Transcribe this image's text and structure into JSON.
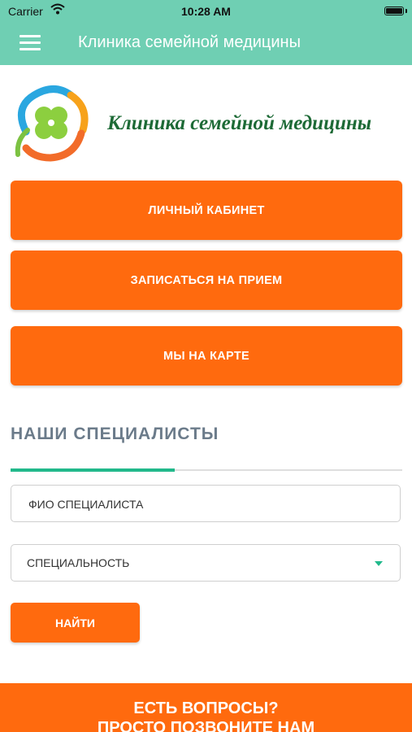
{
  "status_bar": {
    "carrier": "Carrier",
    "time": "10:28 AM"
  },
  "nav": {
    "title": "Клиника семейной медицины",
    "menu_icon": "hamburger-menu-icon"
  },
  "logo": {
    "text": "Клиника семейной медицины",
    "emblem": "clover-logo-icon"
  },
  "buttons": {
    "cabinet": "ЛИЧНЫЙ КАБИНЕТ",
    "appointment": "ЗАПИСАТЬСЯ НА ПРИЕМ",
    "map": "МЫ НА КАРТЕ"
  },
  "specialists": {
    "title": "НАШИ СПЕЦИАЛИСТЫ",
    "name_placeholder": "ФИО СПЕЦИАЛИСТА",
    "specialty_value": "СПЕЦИАЛЬНОСТЬ",
    "find_label": "НАЙТИ"
  },
  "footer": {
    "line1": "ЕСТЬ ВОПРОСЫ?",
    "line2": "ПРОСТО ПОЗВОНИТЕ НАМ"
  },
  "colors": {
    "header": "#6fcfb3",
    "accent_orange": "#ff6a0e",
    "accent_green": "#21b98b",
    "logo_text": "#1d6a36",
    "section_title": "#6b7b8a"
  }
}
